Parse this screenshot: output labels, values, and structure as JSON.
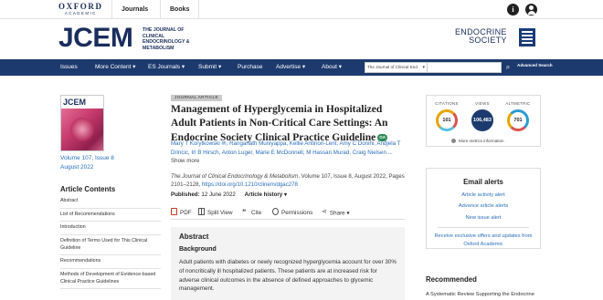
{
  "topbar": {
    "publisher_line1": "OXFORD",
    "publisher_line2": "ACADEMIC",
    "journals": "Journals",
    "books": "Books",
    "info_icon": "info-icon",
    "account_icon": "account-icon"
  },
  "masthead": {
    "journal_abbr": "JCEM",
    "journal_full": "THE JOURNAL OF CLINICAL ENDOCRINOLOGY & METABOLISM",
    "society_line1": "ENDOCRINE",
    "society_line2": "SOCIETY"
  },
  "nav": {
    "items": [
      "Issues",
      "More Content ▾",
      "ES Journals ▾",
      "Submit ▾",
      "Purchase",
      "Advertise ▾",
      "About ▾"
    ],
    "search_scope": "The Journal of Clinical End",
    "search_placeholder": "",
    "advanced_search": "Advanced Search"
  },
  "left": {
    "cover_title": "JCEM",
    "volume": "Volume 107, Issue 8",
    "date": "August 2022",
    "contents_heading": "Article Contents",
    "toc": [
      "Abstract",
      "List of Recommendations",
      "Introduction",
      "Definition of Terms Used for This Clinical Guideline",
      "Recommendations",
      "Methods of Development of Evidence-based Clinical Practice Guidelines"
    ]
  },
  "article": {
    "type_tag": "JOURNAL ARTICLE",
    "title": "Management of Hyperglycemia in Hospitalized Adult Patients in Non-Critical Care Settings: An Endocrine Society Clinical Practice Guideline",
    "open_access_badge": "OA",
    "authors_linked": "Mary T Korytkowski ✉, Ranganath Muniyappa, Kellie Antinori-Lent, Amy C Donihi, Andjela T Drincic, Irl B Hirsch, Anton Luger, Marie E McDonnell, M Hassan Murad, Craig Nielsen ...",
    "show_more": "Show more",
    "journal_name": "The Journal of Clinical Endocrinology & Metabolism",
    "citation_rest": ", Volume 107, Issue 8, August 2022, Pages 2101–2128, ",
    "doi": "https://doi.org/10.1210/clinem/dgac278",
    "published_label": "Published:",
    "published_date": "12 June 2022",
    "history_label": "Article history ▾",
    "tools": [
      "PDF",
      "Split View",
      "Cite",
      "Permissions",
      "Share ▾"
    ]
  },
  "abstract": {
    "heading": "Abstract",
    "section": "Background",
    "text": "Adult patients with diabetes or newly recognized hyperglycemia account for over 30% of noncritically ill hospitalized patients. These patients are at increased risk for adverse clinical outcomes in the absence of defined approaches to glycemic management."
  },
  "metrics": {
    "citations_label": "CITATIONS",
    "citations": "101",
    "views_label": "VIEWS",
    "views": "106,483",
    "altmetric_label": "ALTMETRIC",
    "altmetric": "701",
    "more_info": "More metrics information"
  },
  "alerts": {
    "heading": "Email alerts",
    "links": [
      "Article activity alert",
      "Advance article alerts",
      "New issue alert"
    ],
    "receive": "Receive exclusive offers and updates from Oxford Academic"
  },
  "recommended": {
    "heading": "Recommended",
    "first_item": "A Systematic Review Supporting the Endocrine"
  }
}
